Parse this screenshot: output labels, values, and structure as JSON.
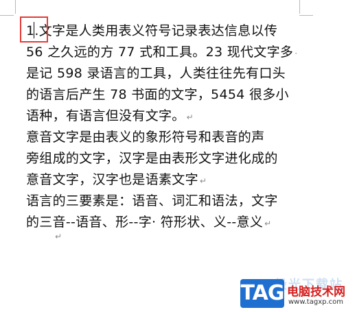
{
  "document": {
    "lines": [
      {
        "text": "1.文字是人类用表义符号记录表达信息以传",
        "mark": ""
      },
      {
        "text": "56 之久远的方 77 式和工具。23 现代文字多",
        "mark": "·"
      },
      {
        "text": "是记 598 录语言的工具，人类往往先有口头",
        "mark": ""
      },
      {
        "text": "的语言后产生 78 书面的文字，5454 很多小",
        "mark": ""
      },
      {
        "text": "语种，有语言但没有文字。",
        "mark": "↵"
      },
      {
        "text": "意音文字是由表义的象形符号和表音的声",
        "mark": ""
      },
      {
        "text": "旁组成的文字，汉字是由表形文字进化成的",
        "mark": ""
      },
      {
        "text": "意音文字，汉字也是语素文字",
        "mark": "↵"
      },
      {
        "text": "语言的三要素是：语音、词汇和语法，文字",
        "mark": ""
      },
      {
        "text": "的三音--语音、形--字· 符形状、义--意义",
        "mark": "↵"
      }
    ],
    "empty_paragraph_mark": "↵"
  },
  "watermark": {
    "logo_text": "TAG",
    "site_name": "电脑技术网",
    "site_url": "www.tagxp.com",
    "faint_text": "极光下载站"
  },
  "colors": {
    "highlight_box": "#e53935",
    "logo_bg": "#1f6fd0",
    "site_name": "#d62020"
  }
}
